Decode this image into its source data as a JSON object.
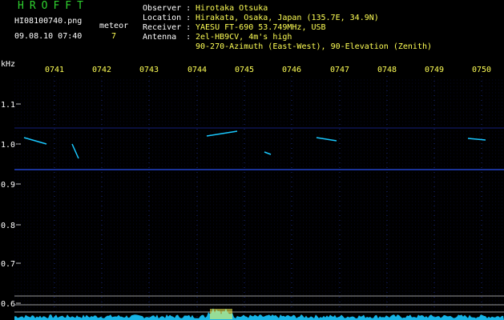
{
  "header": {
    "app_title": "HROFFT",
    "filename": "HI08100740.png",
    "datetime": "09.08.10 07:40",
    "meteor_label": "meteor",
    "meteor_count": "7"
  },
  "info": {
    "observer_label": "Observer :",
    "observer_value": "Hirotaka Otsuka",
    "location_label": "Location :",
    "location_value": "Hirakata, Osaka, Japan (135.7E, 34.9N)",
    "receiver_label": "Receiver :",
    "receiver_value": "YAESU FT-690 53.749MHz, USB",
    "antenna_label": "Antenna  :",
    "antenna_value": "2el-HB9CV, 4m's high",
    "antenna_value2": "90-270-Azimuth (East-West), 90-Elevation (Zenith)"
  },
  "axis": {
    "unit": "kHz",
    "y_ticks": [
      "1.1",
      "1.0",
      "0.9",
      "0.8",
      "0.7",
      "0.6"
    ],
    "time_ticks": [
      "0741",
      "0742",
      "0743",
      "0744",
      "0745",
      "0746",
      "0747",
      "0748",
      "0749",
      "0750"
    ]
  },
  "colors": {
    "title_green": "#2fd12f",
    "label_white": "#ffffff",
    "value_yellow": "#ffff55",
    "signal_blue": "#2b4cff",
    "trace_cyan": "#19c8ff"
  }
}
